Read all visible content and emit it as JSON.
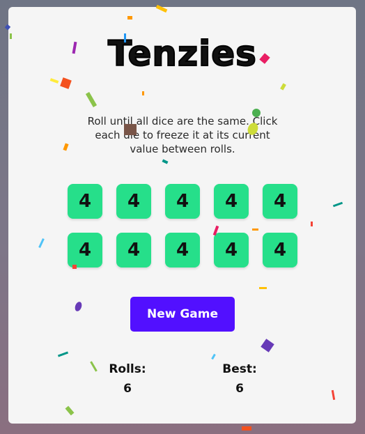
{
  "game": {
    "title": "Tenzies",
    "instructions": "Roll until all dice are the same. Click each die to freeze it at its current value between rolls.",
    "dice": [
      "4",
      "4",
      "4",
      "4",
      "4",
      "4",
      "4",
      "4",
      "4",
      "4"
    ],
    "new_game_label": "New Game",
    "rolls_label": "Rolls:",
    "rolls_value": "6",
    "best_label": "Best:",
    "best_value": "6"
  },
  "colors": {
    "die": "#26df8a",
    "button": "#5210ff",
    "card": "#f5f5f5"
  }
}
